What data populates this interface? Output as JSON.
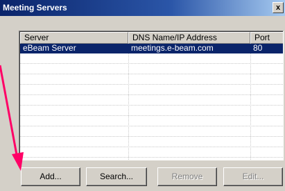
{
  "window": {
    "title": "Meeting Servers",
    "close_label": "x"
  },
  "table": {
    "columns": [
      "Server",
      "DNS Name/IP Address",
      "Port"
    ],
    "rows": [
      {
        "server": "eBeam Server",
        "address": "meetings.e-beam.com",
        "port": "80",
        "selected": true
      }
    ],
    "empty_rows": 10
  },
  "buttons": {
    "add": "Add...",
    "search": "Search...",
    "remove": "Remove",
    "edit": "Edit..."
  },
  "annotation": {
    "arrow_color": "#ff0066"
  },
  "colors": {
    "selection": "#0a246a",
    "face": "#d4d0c8"
  }
}
